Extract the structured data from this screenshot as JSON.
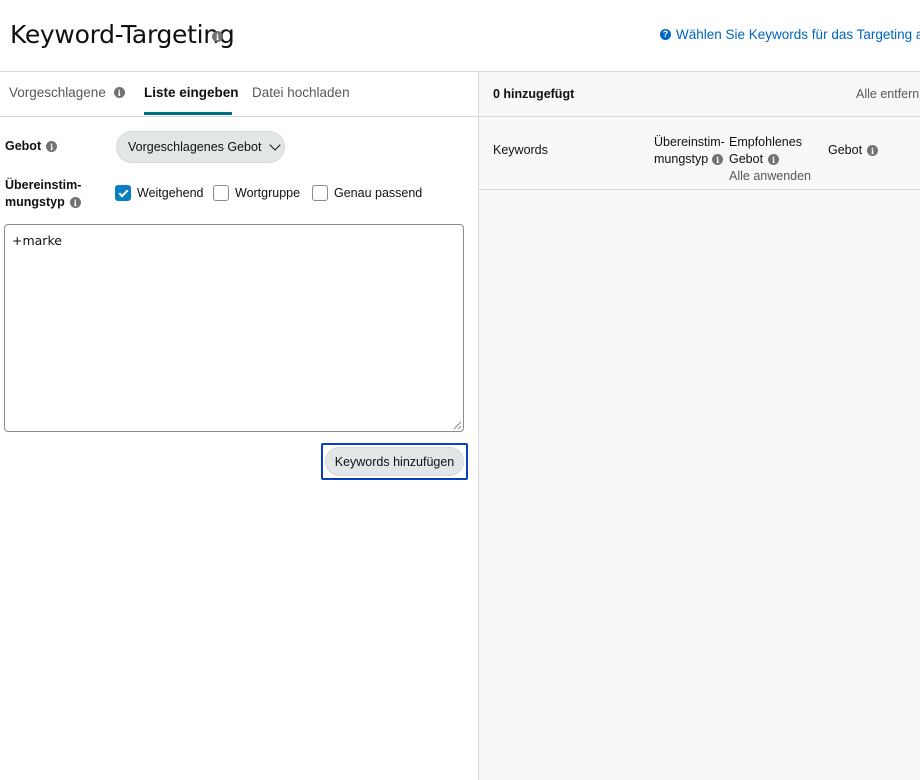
{
  "header": {
    "title": "Keyword-Targeting",
    "help_link": "Wählen Sie Keywords für das Targeting au"
  },
  "tabs": [
    {
      "label": "Vorgeschlagene",
      "active": false
    },
    {
      "label": "Liste eingeben",
      "active": true
    },
    {
      "label": "Datei hochladen",
      "active": false
    }
  ],
  "form": {
    "bid_label": "Gebot",
    "bid_dropdown_value": "Vorgeschlagenes Gebot",
    "match_type_label_line1": "Übereinstim-",
    "match_type_label_line2": "mungstyp",
    "checkboxes": [
      {
        "label": "Weitgehend",
        "checked": true
      },
      {
        "label": "Wortgruppe",
        "checked": false
      },
      {
        "label": "Genau passend",
        "checked": false
      }
    ],
    "keywords_text": "+marke",
    "add_button": "Keywords hinzufügen"
  },
  "right": {
    "added_count": "0 hinzugefügt",
    "remove_all": "Alle entfern",
    "columns": {
      "keywords": "Keywords",
      "match_type_line1": "Übereinstim-",
      "match_type_line2": "mungstyp",
      "suggested_bid_line1": "Empfohlenes",
      "suggested_bid_line2": "Gebot",
      "apply_all": "Alle anwenden",
      "bid": "Gebot"
    }
  },
  "colors": {
    "accent_tab": "#007185",
    "link": "#0066c0",
    "checkbox_checked": "#0a7ec2",
    "focus_outline": "#0a3fbf"
  }
}
